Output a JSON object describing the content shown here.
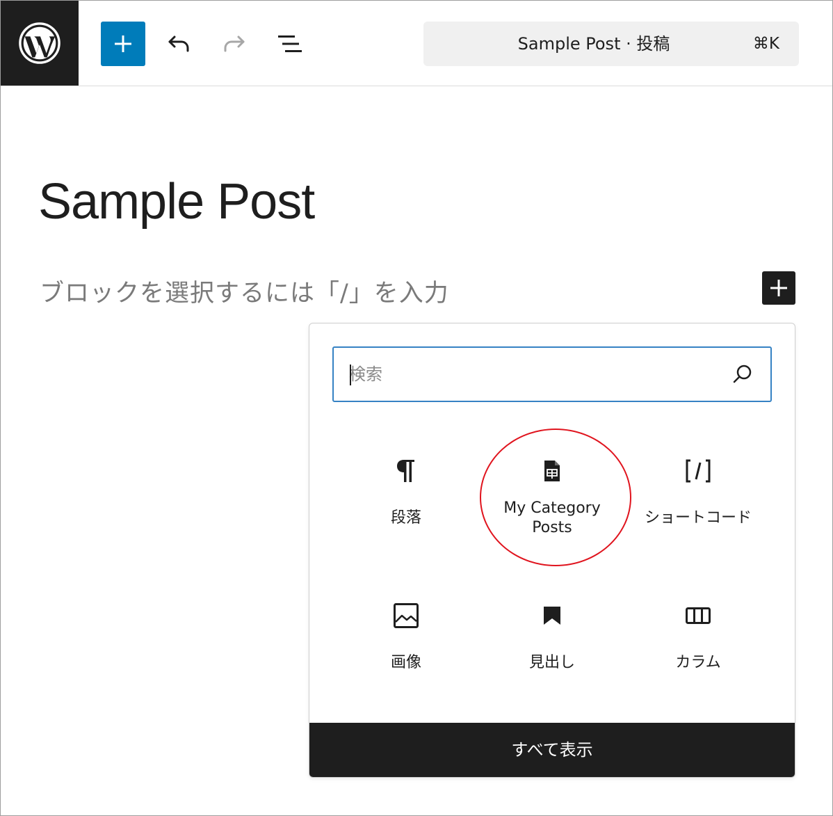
{
  "toolbar": {
    "command_title": "Sample Post · 投稿",
    "command_shortcut": "⌘K"
  },
  "editor": {
    "post_title": "Sample Post",
    "block_placeholder": "ブロックを選択するには「/」を入力"
  },
  "inserter": {
    "search_placeholder": "検索",
    "blocks": [
      {
        "label": "段落",
        "icon": "paragraph-icon"
      },
      {
        "label_line1": "My Category",
        "label_line2": "Posts",
        "icon": "document-icon",
        "highlighted": true
      },
      {
        "label": "ショートコード",
        "icon": "shortcode-icon"
      },
      {
        "label": "画像",
        "icon": "image-icon"
      },
      {
        "label": "見出し",
        "icon": "bookmark-icon"
      },
      {
        "label": "カラム",
        "icon": "columns-icon"
      }
    ],
    "browse_all_label": "すべて表示"
  },
  "colors": {
    "accent": "#007cba",
    "dark": "#1e1e1e",
    "highlight_ring": "#e0141e",
    "search_border": "#3582c4"
  }
}
